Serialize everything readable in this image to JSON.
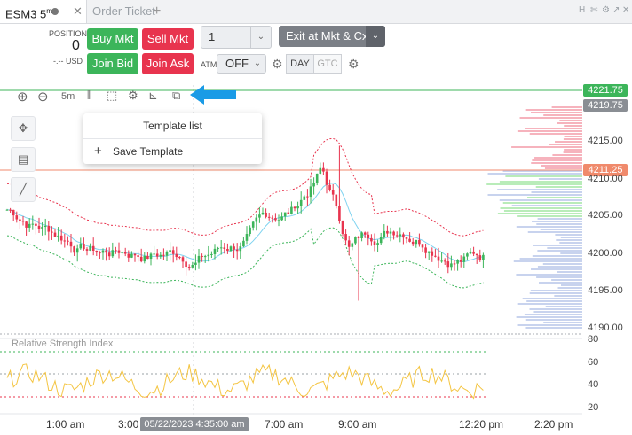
{
  "tabs": [
    {
      "label": "ESM3 5",
      "sup": "m",
      "active": true
    },
    {
      "label": "Order Ticket",
      "active": false
    }
  ],
  "window_controls": [
    "H",
    "✄",
    "⚙",
    "↗",
    "✕"
  ],
  "order_ticket": {
    "position_label": "POSITION",
    "position_value": "0",
    "pnl": "-.-- USD",
    "buy_mkt": "Buy Mkt",
    "sell_mkt": "Sell Mkt",
    "join_bid": "Join Bid",
    "join_ask": "Join Ask",
    "quantity": "1",
    "exit_label": "Exit at Mkt & Cxl",
    "atm_label": "ATM",
    "atm_value": "OFF",
    "session_day": "DAY",
    "session_gtc": "GTC"
  },
  "chart_toolbar": {
    "interval": "5m"
  },
  "template_menu": {
    "title": "Template list",
    "save": "Save Template"
  },
  "price_axis": {
    "labels": [
      "4215.00",
      "4210.00",
      "4205.00",
      "4200.00",
      "4195.00",
      "4190.00"
    ],
    "tags": [
      {
        "value": "4221.75",
        "color": "#3cb55a"
      },
      {
        "value": "4219.75",
        "color": "#8a8e94"
      },
      {
        "value": "4211.25",
        "color": "#f08a6c"
      }
    ]
  },
  "indicator": {
    "name": "Relative Strength Index",
    "levels": [
      "80",
      "60",
      "40",
      "20"
    ]
  },
  "time_axis": {
    "labels": [
      "1:00 am",
      "3:00",
      "7:00 am",
      "9:00 am",
      "12:20 pm",
      "2:20 pm"
    ],
    "cursor": "05/22/2023 4:35:00 am"
  },
  "colors": {
    "up": "#3cb55a",
    "down": "#e8344e",
    "accent": "#1a9be6"
  }
}
